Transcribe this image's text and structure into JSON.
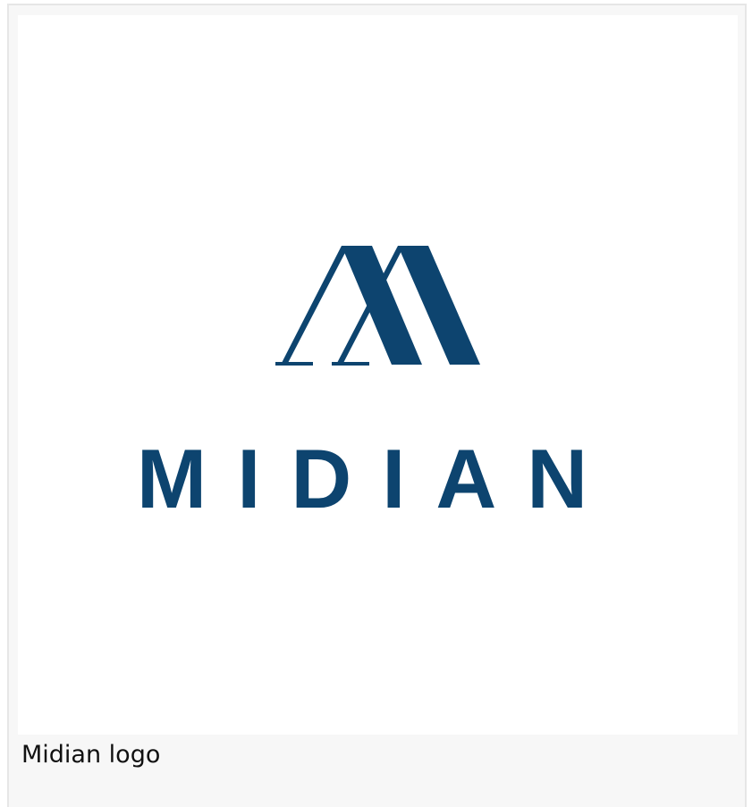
{
  "figure": {
    "caption": "Midian logo"
  },
  "logo": {
    "brand_name": "MIDIAN",
    "icon": "midian-m-monogram-icon",
    "color": "#0d446f"
  },
  "colors": {
    "frame_border": "#e6e6e6",
    "caption_background": "#f7f7f7",
    "image_background": "#ffffff"
  }
}
